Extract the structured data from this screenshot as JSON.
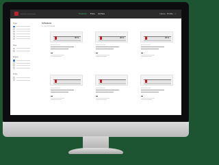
{
  "topbar": {
    "brand": "——— ————",
    "nav": [
      "Products",
      "Price",
      "Archive"
    ],
    "user": "Home · Profile · ⌕"
  },
  "page": {
    "title": "Window",
    "results": "1 – 6 of 6 results"
  },
  "sidebar": {
    "sections": [
      "Type",
      "Size",
      "Brand",
      "Price"
    ]
  },
  "cards": [
    {
      "badge": "50 %"
    },
    {
      "badge": "30 %"
    },
    {
      "badge": "20 %"
    },
    {
      "badge": ""
    },
    {
      "badge": ""
    },
    {
      "badge": ""
    }
  ],
  "colors": {
    "background": "#1d5432",
    "topbar": "#2b2b2b",
    "accent": "#3cb371",
    "brand_red": "#c21f2b"
  }
}
